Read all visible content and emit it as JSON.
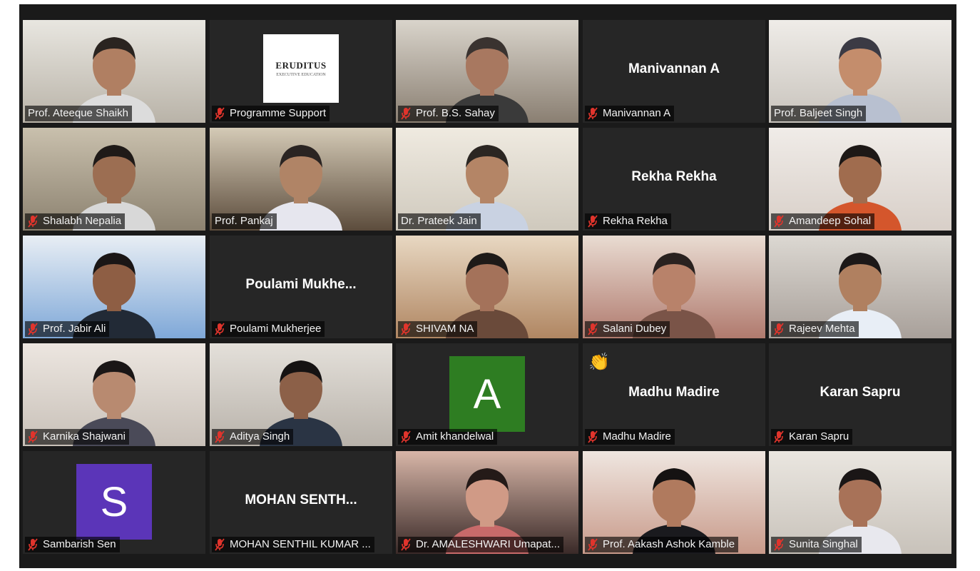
{
  "meeting": {
    "participants": [
      {
        "name": "Prof.  Ateeque Shaikh",
        "type": "video",
        "active": true,
        "muted": false,
        "bg": [
          "#b9b3a8",
          "#e8e6e0"
        ],
        "shirt": "#dcdcdc",
        "skin": "#b07f62",
        "hair": "#2a2420"
      },
      {
        "name": "Programme Support",
        "type": "logo",
        "muted": true,
        "logo_title": "ERUDITUS",
        "logo_subtitle": "EXECUTIVE EDUCATION"
      },
      {
        "name": "Prof.  B.S. Sahay",
        "type": "video",
        "muted": true,
        "bg": [
          "#8a7f72",
          "#d9d4cb"
        ],
        "shirt": "#3a3a3a",
        "skin": "#a87860",
        "hair": "#3a3330"
      },
      {
        "name": "Manivannan A",
        "type": "name",
        "muted": true,
        "center_name": "Manivannan A"
      },
      {
        "name": "Prof.  Baljeet Singh",
        "type": "video",
        "muted": false,
        "bg": [
          "#c8c3bc",
          "#efece8"
        ],
        "shirt": "#b8c0d0",
        "skin": "#c48d6c",
        "hair": "#3b3a44"
      },
      {
        "name": "Shalabh Nepalia",
        "type": "video",
        "muted": true,
        "bg": [
          "#8c8270",
          "#c9c0ad"
        ],
        "shirt": "#d8d8d8",
        "skin": "#9c6e52",
        "hair": "#1f1a18"
      },
      {
        "name": "Prof. Pankaj",
        "type": "video",
        "muted": false,
        "bg": [
          "#5c4c3c",
          "#d4cab6"
        ],
        "shirt": "#e6e6ee",
        "skin": "#b08466",
        "hair": "#2a2422"
      },
      {
        "name": "Dr. Prateek Jain",
        "type": "video",
        "muted": false,
        "bg": [
          "#cfc9bd",
          "#efeae0"
        ],
        "shirt": "#c9d2e2",
        "skin": "#b48566",
        "hair": "#2b2622"
      },
      {
        "name": "Rekha Rekha",
        "type": "name",
        "muted": true,
        "center_name": "Rekha Rekha"
      },
      {
        "name": "Amandeep Sohal",
        "type": "video",
        "muted": true,
        "bg": [
          "#d8cfc8",
          "#f0ece8"
        ],
        "shirt": "#d4562c",
        "skin": "#a06c4e",
        "hair": "#1d1816"
      },
      {
        "name": "Prof.  Jabir Ali",
        "type": "video",
        "muted": true,
        "bg": [
          "#7fa8d8",
          "#e8eef4"
        ],
        "shirt": "#222a36",
        "skin": "#8e5e44",
        "hair": "#1a1616"
      },
      {
        "name": "Poulami Mukherjee",
        "type": "name",
        "muted": true,
        "center_name": "Poulami  Mukhe..."
      },
      {
        "name": "SHIVAM NA",
        "type": "video",
        "muted": true,
        "bg": [
          "#b08662",
          "#e8d8c2"
        ],
        "shirt": "#6a4a3a",
        "skin": "#a4725a",
        "hair": "#1e1a18"
      },
      {
        "name": "Salani Dubey",
        "type": "video",
        "muted": true,
        "bg": [
          "#b07a6e",
          "#e9dcd2"
        ],
        "shirt": "#7a5448",
        "skin": "#b8826a",
        "hair": "#2a2220"
      },
      {
        "name": "Rajeev Mehta",
        "type": "video",
        "muted": true,
        "bg": [
          "#a8a09a",
          "#dcd8d2"
        ],
        "shirt": "#e8eef6",
        "skin": "#b08060",
        "hair": "#1c1818"
      },
      {
        "name": "Karnika Shajwani",
        "type": "video",
        "muted": true,
        "bg": [
          "#c8c0b8",
          "#ece6e0"
        ],
        "shirt": "#4a4a58",
        "skin": "#b88a70",
        "hair": "#1a1616"
      },
      {
        "name": "Aditya Singh",
        "type": "video",
        "muted": true,
        "bg": [
          "#b8b2aa",
          "#e4e0da"
        ],
        "shirt": "#2a3444",
        "skin": "#8c6048",
        "hair": "#151212"
      },
      {
        "name": "Amit khandelwal",
        "type": "avatar",
        "muted": true,
        "letter": "A",
        "color": "#2e7d22"
      },
      {
        "name": "Madhu Madire",
        "type": "name",
        "muted": true,
        "center_name": "Madhu Madire",
        "hand_raised": true
      },
      {
        "name": "Karan Sapru",
        "type": "name",
        "muted": true,
        "center_name": "Karan Sapru"
      },
      {
        "name": "Sambarish Sen",
        "type": "avatar",
        "muted": true,
        "letter": "S",
        "color": "#5b35b8"
      },
      {
        "name": "MOHAN SENTHIL KUMAR ...",
        "type": "name",
        "muted": true,
        "center_name": "MOHAN  SENTH..."
      },
      {
        "name": "Dr. AMALESHWARI Umapat...",
        "type": "video",
        "muted": true,
        "bg": [
          "#3a2a28",
          "#d8b6a8"
        ],
        "shirt": "#c86a6a",
        "skin": "#d09a86",
        "hair": "#241a18"
      },
      {
        "name": "Prof.  Aakash Ashok Kamble",
        "type": "video",
        "muted": true,
        "bg": [
          "#c89a8a",
          "#efe6e0"
        ],
        "shirt": "#1a1a1e",
        "skin": "#b07a5e",
        "hair": "#151212"
      },
      {
        "name": "Sunita Singhal",
        "type": "video",
        "muted": true,
        "bg": [
          "#c8c2ba",
          "#eae6e0"
        ],
        "shirt": "#e8e8ee",
        "skin": "#a87258",
        "hair": "#1a1616"
      }
    ],
    "hand_icon": "👏",
    "colors": {
      "active_border": "#c6e02c",
      "mute_icon": "#e0342c",
      "tile_bg": "#262626"
    }
  }
}
